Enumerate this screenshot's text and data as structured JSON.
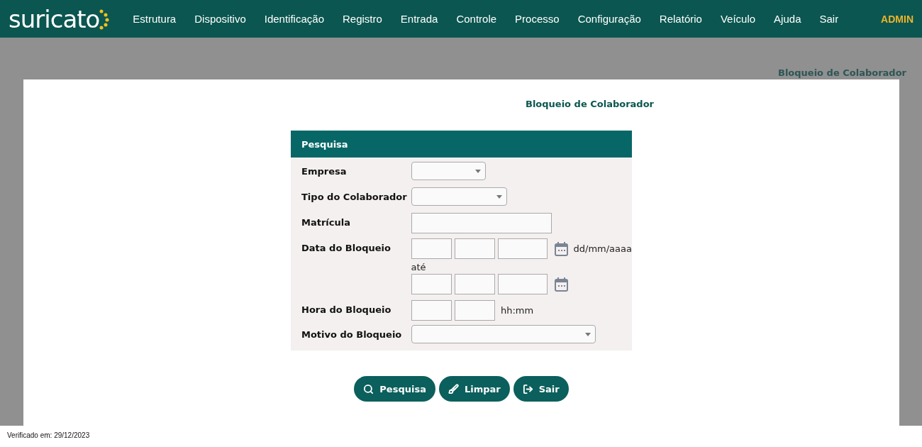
{
  "header": {
    "logo": "suricato",
    "menu": [
      {
        "label": "Estrutura"
      },
      {
        "label": "Dispositivo"
      },
      {
        "label": "Identificação"
      },
      {
        "label": "Registro"
      },
      {
        "label": "Entrada"
      },
      {
        "label": "Controle"
      },
      {
        "label": "Processo"
      },
      {
        "label": "Configuração"
      },
      {
        "label": "Relatório"
      },
      {
        "label": "Veículo"
      },
      {
        "label": "Ajuda"
      },
      {
        "label": "Sair"
      }
    ],
    "user": "ADMIN"
  },
  "breadcrumb": "Bloqueio de Colaborador",
  "page_title": "Bloqueio de Colaborador",
  "form": {
    "title": "Pesquisa",
    "rows": [
      {
        "kind": "select",
        "label": "Empresa"
      },
      {
        "kind": "select",
        "label": "Tipo do Colaborador"
      },
      {
        "kind": "text",
        "label": "Matrícula"
      },
      {
        "kind": "daterange",
        "label": "Data do Bloqueio",
        "hint": "dd/mm/aaaa",
        "separator": "até"
      },
      {
        "kind": "time",
        "label": "Hora do Bloqueio",
        "hint": "hh:mm"
      },
      {
        "kind": "select",
        "label": "Motivo do Bloqueio"
      }
    ]
  },
  "buttons": [
    {
      "kind": "search",
      "label": "Pesquisa"
    },
    {
      "kind": "clear",
      "label": "Limpar"
    },
    {
      "kind": "exit",
      "label": "Sair"
    }
  ],
  "footer": "Verificado em: 29/12/2023"
}
